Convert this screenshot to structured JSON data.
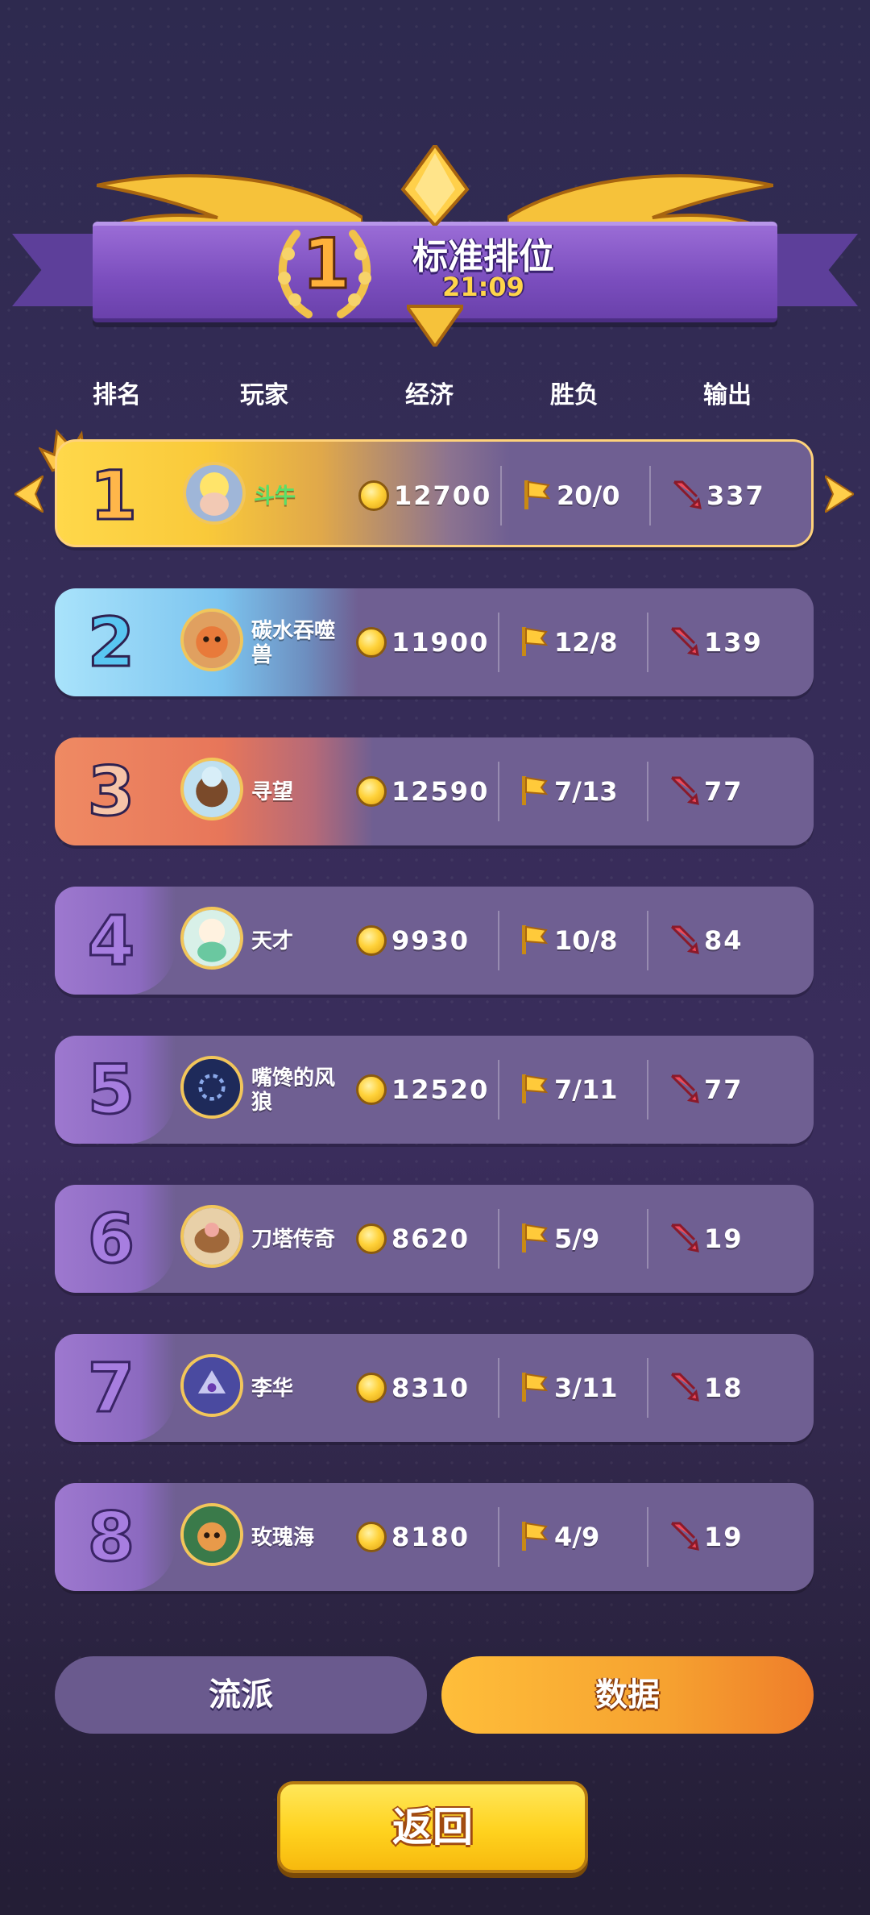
{
  "header": {
    "rank": "1",
    "mode": "标准排位",
    "time": "21:09"
  },
  "columns": [
    "排名",
    "玩家",
    "经济",
    "胜负",
    "输出"
  ],
  "rows": [
    {
      "rank": "1",
      "name": "斗牛",
      "gold": "12700",
      "wl": "20/0",
      "dmg": "337"
    },
    {
      "rank": "2",
      "name": "碳水吞噬兽",
      "gold": "11900",
      "wl": "12/8",
      "dmg": "139"
    },
    {
      "rank": "3",
      "name": "寻望",
      "gold": "12590",
      "wl": "7/13",
      "dmg": "77"
    },
    {
      "rank": "4",
      "name": "天才",
      "gold": "9930",
      "wl": "10/8",
      "dmg": "84"
    },
    {
      "rank": "5",
      "name": "嘴馋的风狼",
      "gold": "12520",
      "wl": "7/11",
      "dmg": "77"
    },
    {
      "rank": "6",
      "name": "刀塔传奇",
      "gold": "8620",
      "wl": "5/9",
      "dmg": "19"
    },
    {
      "rank": "7",
      "name": "李华",
      "gold": "8310",
      "wl": "3/11",
      "dmg": "18"
    },
    {
      "rank": "8",
      "name": "玫瑰海",
      "gold": "8180",
      "wl": "4/9",
      "dmg": "19"
    }
  ],
  "tabs": {
    "style": "流派",
    "data": "数据"
  },
  "back": "返回",
  "colors": {
    "name_highlight": "#58e06a",
    "gold_accent": "#ffd54a",
    "tab_active": "#f6a230"
  }
}
